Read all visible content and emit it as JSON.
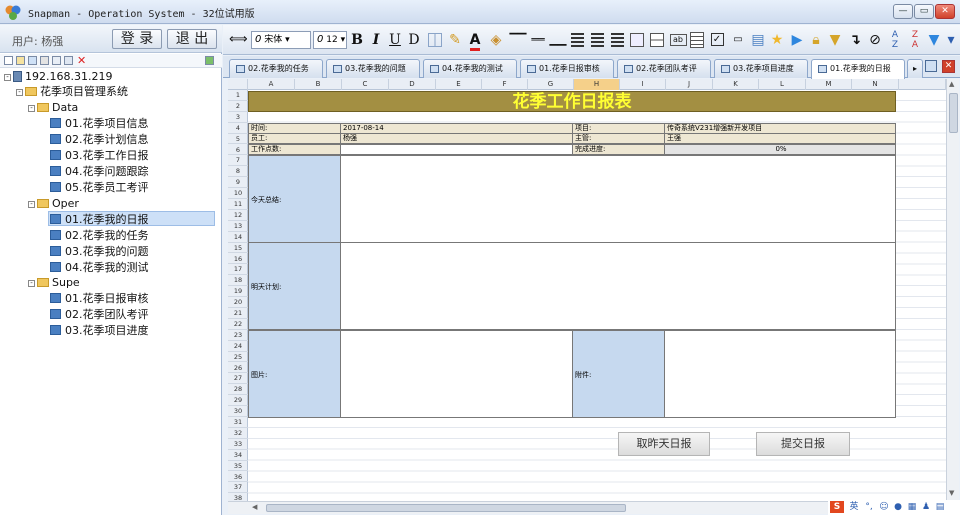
{
  "window": {
    "title": "Snapman - Operation System - 32位试用版",
    "btn_min": "—",
    "btn_max": "▭",
    "btn_close": "✕"
  },
  "user": {
    "label": "用户: 杨强",
    "login": "登 录",
    "logout": "退 出"
  },
  "tree": {
    "server": "192.168.31.219",
    "project": "花季项目管理系统",
    "groups": [
      {
        "name": "Data",
        "items": [
          "01.花季项目信息",
          "02.花季计划信息",
          "03.花季工作日报",
          "04.花季问题跟踪",
          "05.花季员工考评"
        ]
      },
      {
        "name": "Oper",
        "items": [
          "01.花季我的日报",
          "02.花季我的任务",
          "03.花季我的问题",
          "04.花季我的测试"
        ]
      },
      {
        "name": "Supe",
        "items": [
          "01.花季日报审核",
          "02.花季团队考评",
          "03.花季项目进度"
        ]
      }
    ]
  },
  "toolbar": {
    "font_name": "宋体",
    "font_size": "12",
    "bold": "B",
    "italic": "I",
    "underline": "U",
    "strike": "D"
  },
  "tabs": [
    "02.花季我的任务",
    "03.花季我的问题",
    "04.花季我的测试",
    "01.花季日报审核",
    "02.花季团队考评",
    "03.花季项目进度",
    "01.花季我的日报"
  ],
  "sheet": {
    "columns": [
      "A",
      "B",
      "C",
      "D",
      "E",
      "F",
      "G",
      "H",
      "I",
      "J",
      "K",
      "L",
      "M",
      "N"
    ],
    "highlight_col": "H",
    "rows": [
      "1",
      "2",
      "3",
      "4",
      "5",
      "6",
      "7",
      "8",
      "9",
      "10",
      "11",
      "12",
      "13",
      "14",
      "15",
      "16",
      "17",
      "18",
      "19",
      "20",
      "21",
      "22",
      "23",
      "24",
      "25",
      "26",
      "27",
      "28",
      "29",
      "30",
      "31",
      "32",
      "33",
      "34",
      "35",
      "36",
      "37",
      "38"
    ],
    "title": "花季工作日报表",
    "time_label": "时间:",
    "time_value": "2017-08-14",
    "project_label": "项目:",
    "project_value": "传奇系统V231增强新开发项目",
    "employee_label": "员工:",
    "employee_value": "杨强",
    "manager_label": "主管:",
    "manager_value": "王强",
    "workpoints_label": "工作点数:",
    "progress_label": "完成进度:",
    "progress_value": "0%",
    "today_label": "今天总结:",
    "tomorrow_label": "明天计划:",
    "picture_label": "图片:",
    "attachment_label": "附件:",
    "btn_yesterday": "取昨天日报",
    "btn_submit": "提交日报"
  },
  "colors": {
    "banner_bg": "#a38f42",
    "banner_text": "#ffff33",
    "label_blue": "#c6d9ef",
    "label_beige": "#eee7d3"
  },
  "statusbar": {
    "ime": "英"
  }
}
